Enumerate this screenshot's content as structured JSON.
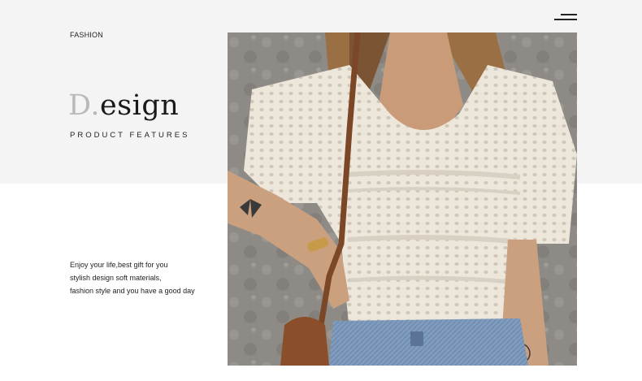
{
  "header": {
    "section_label": "FASHION",
    "menu_icon": "hamburger-menu-icon"
  },
  "hero": {
    "title_initial": "D.",
    "title_rest": "esign",
    "subtitle": "PRODUCT FEATURES"
  },
  "description": {
    "lines": [
      "Enjoy your life,best gift for you",
      "stylish design soft materials,",
      "fashion style and you have a good day"
    ]
  },
  "colors": {
    "top_band": "#f4f4f4",
    "page_background": "#ffffff",
    "title_text": "#1a1a1a",
    "title_initial_dim": "#b9b9b9"
  }
}
